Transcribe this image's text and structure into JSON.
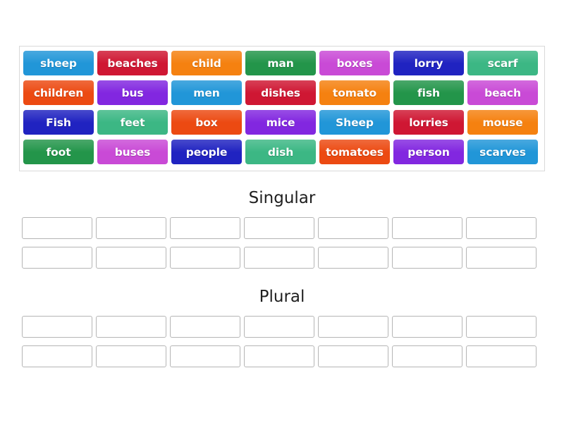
{
  "activity": {
    "type": "group-sort",
    "groups": [
      {
        "title": "Singular",
        "zone_rows": 2,
        "zones_per_row": 7,
        "placed_words": []
      },
      {
        "title": "Plural",
        "zone_rows": 2,
        "zones_per_row": 7,
        "placed_words": []
      }
    ]
  },
  "word_bank": {
    "rows": [
      [
        {
          "label": "sheep",
          "color": "#2196d8"
        },
        {
          "label": "beaches",
          "color": "#cf1733"
        },
        {
          "label": "child",
          "color": "#f58110"
        },
        {
          "label": "man",
          "color": "#23954a"
        },
        {
          "label": "boxes",
          "color": "#c94ad6"
        },
        {
          "label": "lorry",
          "color": "#2023c1"
        },
        {
          "label": "scarf",
          "color": "#3cb784"
        }
      ],
      [
        {
          "label": "children",
          "color": "#ec4a12"
        },
        {
          "label": "bus",
          "color": "#8227e0"
        },
        {
          "label": "men",
          "color": "#2196d8"
        },
        {
          "label": "dishes",
          "color": "#cf1733"
        },
        {
          "label": "tomato",
          "color": "#f58110"
        },
        {
          "label": "fish",
          "color": "#23954a"
        },
        {
          "label": "beach",
          "color": "#c94ad6"
        }
      ],
      [
        {
          "label": "Fish",
          "color": "#2023c1"
        },
        {
          "label": "feet",
          "color": "#3cb784"
        },
        {
          "label": "box",
          "color": "#ec4a12"
        },
        {
          "label": "mice",
          "color": "#8227e0"
        },
        {
          "label": "Sheep",
          "color": "#2196d8"
        },
        {
          "label": "lorries",
          "color": "#cf1733"
        },
        {
          "label": "mouse",
          "color": "#f58110"
        }
      ],
      [
        {
          "label": "foot",
          "color": "#23954a"
        },
        {
          "label": "buses",
          "color": "#c94ad6"
        },
        {
          "label": "people",
          "color": "#2023c1"
        },
        {
          "label": "dish",
          "color": "#3cb784"
        },
        {
          "label": "tomatoes",
          "color": "#ec4a12"
        },
        {
          "label": "person",
          "color": "#8227e0"
        },
        {
          "label": "scarves",
          "color": "#2196d8"
        }
      ]
    ]
  },
  "palette": {
    "page_background": "#ffffff",
    "panel_border": "#d9d9d9",
    "zone_border": "#b5b5b5",
    "zone_fill": "#ffffff",
    "heading_text": "#1f1f1f",
    "tile_text": "#ffffff"
  }
}
